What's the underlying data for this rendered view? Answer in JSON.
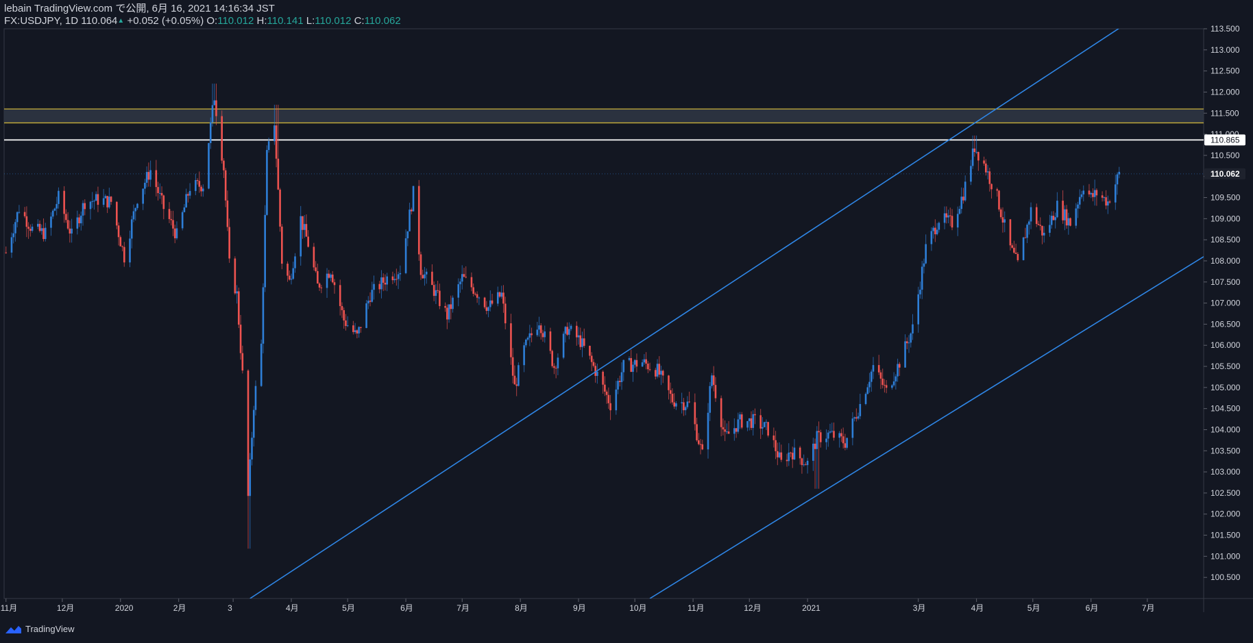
{
  "header": {
    "line1": "lebain TradingView.com で公開, 6月 16, 2021 14:16:34 JST",
    "symbol": "FX:USDJPY, 1D",
    "last": "110.064",
    "arrow": "▲",
    "change": "+0.052 (+0.05%)",
    "o_label": "O:",
    "o_value": "110.012",
    "h_label": "H:",
    "h_value": "110.141",
    "l_label": "L:",
    "l_value": "110.012",
    "c_label": "C:",
    "c_value": "110.062"
  },
  "footer": {
    "brand": "TradingView",
    "logo_icon": "tradingview-cloud-icon"
  },
  "colors": {
    "background": "#131722",
    "up": "#2e7fd8",
    "down": "#ef5350",
    "trendline": "#2f86e6",
    "zone_fill": "#2f3542",
    "zone_border": "#c9b03a",
    "level_line": "#ffffff",
    "axis_text": "#d1d4dc",
    "grid": "#1c2030"
  },
  "chart_data": {
    "type": "candlestick",
    "symbol": "FX:USDJPY",
    "interval": "1D",
    "ylim": [
      100.0,
      113.5
    ],
    "yticks": [
      100.5,
      101.0,
      101.5,
      102.0,
      102.5,
      103.0,
      103.5,
      104.0,
      104.5,
      105.0,
      105.5,
      106.0,
      106.5,
      107.0,
      107.5,
      108.0,
      108.5,
      109.0,
      109.5,
      110.0,
      110.5,
      111.0,
      111.5,
      112.0,
      112.5,
      113.0,
      113.5
    ],
    "xlim": [
      "2019-10-31",
      "2021-07-31"
    ],
    "xticks": [
      {
        "label": "11月",
        "date": "2019-11-01"
      },
      {
        "label": "12月",
        "date": "2019-12-01"
      },
      {
        "label": "2020",
        "date": "2020-01-01"
      },
      {
        "label": "2月",
        "date": "2020-02-01"
      },
      {
        "label": "3",
        "date": "2020-03-01"
      },
      {
        "label": "4月",
        "date": "2020-04-01"
      },
      {
        "label": "5月",
        "date": "2020-05-01"
      },
      {
        "label": "6月",
        "date": "2020-06-01"
      },
      {
        "label": "7月",
        "date": "2020-07-01"
      },
      {
        "label": "8月",
        "date": "2020-08-01"
      },
      {
        "label": "9月",
        "date": "2020-09-01"
      },
      {
        "label": "10月",
        "date": "2020-10-01"
      },
      {
        "label": "11月",
        "date": "2020-11-01"
      },
      {
        "label": "12月",
        "date": "2020-12-01"
      },
      {
        "label": "2021",
        "date": "2021-01-01"
      },
      {
        "label": "3月",
        "date": "2021-03-01"
      },
      {
        "label": "4月",
        "date": "2021-04-01"
      },
      {
        "label": "5月",
        "date": "2021-05-01"
      },
      {
        "label": "6月",
        "date": "2021-06-01"
      },
      {
        "label": "7月",
        "date": "2021-07-01"
      }
    ],
    "price_labels": [
      {
        "value": 110.865,
        "text": "110.865",
        "style": "level"
      },
      {
        "value": 110.062,
        "text": "110.062",
        "style": "last"
      }
    ],
    "horizontal_zone": {
      "from": 111.27,
      "to": 111.6
    },
    "horizontal_line": {
      "value": 110.865
    },
    "trendlines": [
      {
        "p1": {
          "date": "2020-03-10",
          "value": 100.0
        },
        "p2": {
          "date": "2021-06-19",
          "value": 113.6
        }
      },
      {
        "p1": {
          "date": "2020-10-09",
          "value": 100.0
        },
        "p2": {
          "date": "2021-07-31",
          "value": 108.1
        }
      }
    ],
    "close_path": [
      {
        "date": "2019-11-01",
        "close": 108.2
      },
      {
        "date": "2019-11-08",
        "close": 109.25
      },
      {
        "date": "2019-11-15",
        "close": 108.75
      },
      {
        "date": "2019-11-22",
        "close": 108.65
      },
      {
        "date": "2019-11-29",
        "close": 109.5
      },
      {
        "date": "2019-12-06",
        "close": 108.6
      },
      {
        "date": "2019-12-13",
        "close": 109.4
      },
      {
        "date": "2019-12-20",
        "close": 109.45
      },
      {
        "date": "2019-12-27",
        "close": 109.4
      },
      {
        "date": "2020-01-03",
        "close": 108.1
      },
      {
        "date": "2020-01-10",
        "close": 109.5
      },
      {
        "date": "2020-01-17",
        "close": 110.15
      },
      {
        "date": "2020-01-24",
        "close": 109.25
      },
      {
        "date": "2020-01-31",
        "close": 108.6
      },
      {
        "date": "2020-02-07",
        "close": 109.75
      },
      {
        "date": "2020-02-14",
        "close": 109.8
      },
      {
        "date": "2020-02-20",
        "close": 111.9
      },
      {
        "date": "2020-02-25",
        "close": 110.2
      },
      {
        "date": "2020-02-28",
        "close": 107.9
      },
      {
        "date": "2020-03-03",
        "close": 107.2
      },
      {
        "date": "2020-03-06",
        "close": 105.3
      },
      {
        "date": "2020-03-09",
        "close": 102.4
      },
      {
        "date": "2020-03-12",
        "close": 104.6
      },
      {
        "date": "2020-03-16",
        "close": 106.0
      },
      {
        "date": "2020-03-19",
        "close": 110.5
      },
      {
        "date": "2020-03-23",
        "close": 111.3
      },
      {
        "date": "2020-03-27",
        "close": 108.0
      },
      {
        "date": "2020-03-31",
        "close": 107.5
      },
      {
        "date": "2020-04-06",
        "close": 109.0
      },
      {
        "date": "2020-04-10",
        "close": 108.4
      },
      {
        "date": "2020-04-15",
        "close": 107.4
      },
      {
        "date": "2020-04-22",
        "close": 107.8
      },
      {
        "date": "2020-04-29",
        "close": 106.6
      },
      {
        "date": "2020-05-06",
        "close": 106.2
      },
      {
        "date": "2020-05-13",
        "close": 107.2
      },
      {
        "date": "2020-05-22",
        "close": 107.6
      },
      {
        "date": "2020-05-29",
        "close": 107.8
      },
      {
        "date": "2020-06-05",
        "close": 109.6
      },
      {
        "date": "2020-06-09",
        "close": 107.8
      },
      {
        "date": "2020-06-16",
        "close": 107.3
      },
      {
        "date": "2020-06-23",
        "close": 106.7
      },
      {
        "date": "2020-07-01",
        "close": 107.6
      },
      {
        "date": "2020-07-08",
        "close": 107.3
      },
      {
        "date": "2020-07-15",
        "close": 106.9
      },
      {
        "date": "2020-07-22",
        "close": 107.2
      },
      {
        "date": "2020-07-29",
        "close": 105.0
      },
      {
        "date": "2020-08-03",
        "close": 105.9
      },
      {
        "date": "2020-08-11",
        "close": 106.6
      },
      {
        "date": "2020-08-19",
        "close": 105.5
      },
      {
        "date": "2020-08-26",
        "close": 106.4
      },
      {
        "date": "2020-09-02",
        "close": 106.1
      },
      {
        "date": "2020-09-10",
        "close": 105.4
      },
      {
        "date": "2020-09-18",
        "close": 104.6
      },
      {
        "date": "2020-09-25",
        "close": 105.5
      },
      {
        "date": "2020-10-05",
        "close": 105.6
      },
      {
        "date": "2020-10-13",
        "close": 105.4
      },
      {
        "date": "2020-10-21",
        "close": 104.7
      },
      {
        "date": "2020-10-30",
        "close": 104.6
      },
      {
        "date": "2020-11-06",
        "close": 103.4
      },
      {
        "date": "2020-11-11",
        "close": 105.3
      },
      {
        "date": "2020-11-18",
        "close": 103.8
      },
      {
        "date": "2020-11-26",
        "close": 104.2
      },
      {
        "date": "2020-12-04",
        "close": 104.2
      },
      {
        "date": "2020-12-11",
        "close": 104.0
      },
      {
        "date": "2020-12-18",
        "close": 103.2
      },
      {
        "date": "2020-12-23",
        "close": 103.5
      },
      {
        "date": "2021-01-01",
        "close": 103.2
      },
      {
        "date": "2021-01-06",
        "close": 103.8
      },
      {
        "date": "2021-01-13",
        "close": 103.9
      },
      {
        "date": "2021-01-21",
        "close": 103.7
      },
      {
        "date": "2021-01-29",
        "close": 104.6
      },
      {
        "date": "2021-02-05",
        "close": 105.5
      },
      {
        "date": "2021-02-12",
        "close": 104.9
      },
      {
        "date": "2021-02-19",
        "close": 105.6
      },
      {
        "date": "2021-02-26",
        "close": 106.4
      },
      {
        "date": "2021-03-05",
        "close": 108.3
      },
      {
        "date": "2021-03-12",
        "close": 109.0
      },
      {
        "date": "2021-03-19",
        "close": 108.9
      },
      {
        "date": "2021-03-25",
        "close": 109.6
      },
      {
        "date": "2021-03-31",
        "close": 110.7
      },
      {
        "date": "2021-04-05",
        "close": 110.3
      },
      {
        "date": "2021-04-12",
        "close": 109.5
      },
      {
        "date": "2021-04-19",
        "close": 108.3
      },
      {
        "date": "2021-04-23",
        "close": 107.9
      },
      {
        "date": "2021-04-30",
        "close": 109.2
      },
      {
        "date": "2021-05-07",
        "close": 108.6
      },
      {
        "date": "2021-05-14",
        "close": 109.3
      },
      {
        "date": "2021-05-21",
        "close": 108.9
      },
      {
        "date": "2021-05-28",
        "close": 109.8
      },
      {
        "date": "2021-06-01",
        "close": 109.5
      },
      {
        "date": "2021-06-04",
        "close": 109.6
      },
      {
        "date": "2021-06-10",
        "close": 109.4
      },
      {
        "date": "2021-06-16",
        "close": 110.06
      }
    ],
    "extremes": [
      {
        "date": "2020-02-20",
        "high": 112.2
      },
      {
        "date": "2020-03-09",
        "low": 101.18
      },
      {
        "date": "2020-03-24",
        "high": 111.7
      },
      {
        "date": "2021-01-06",
        "low": 102.6
      },
      {
        "date": "2021-03-31",
        "high": 110.97
      }
    ]
  }
}
